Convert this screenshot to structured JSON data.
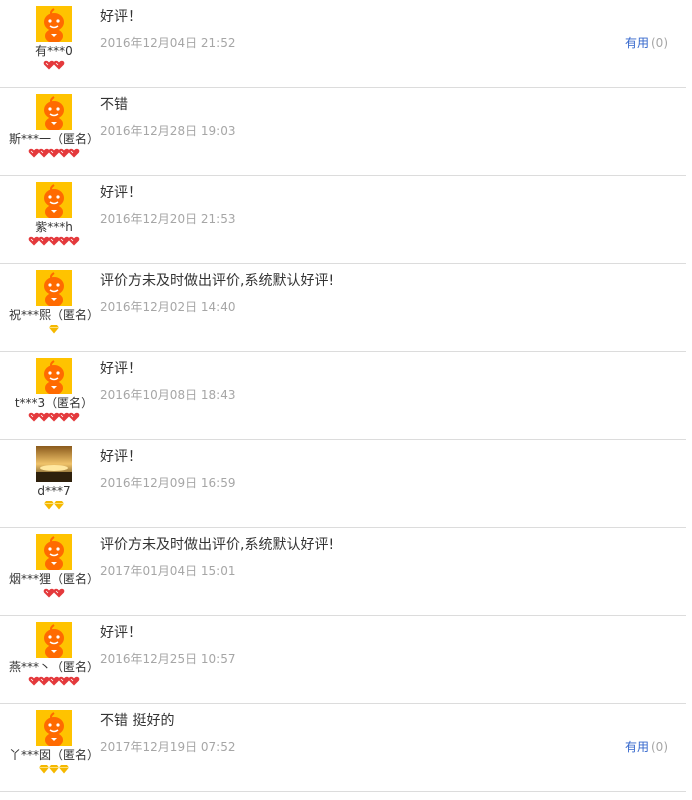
{
  "reviews": [
    {
      "comment": "好评！",
      "date": "2016年12月04日 21:52",
      "user": "有***0",
      "avatar": "taobao-mascot",
      "rank_icon": "red-heart",
      "rank_count": 2,
      "useful": {
        "label": "有用",
        "count": "(0)"
      }
    },
    {
      "comment": "不错",
      "date": "2016年12月28日 19:03",
      "user": "斯***一（匿名）",
      "avatar": "taobao-mascot",
      "rank_icon": "red-heart",
      "rank_count": 5
    },
    {
      "comment": "好评！",
      "date": "2016年12月20日 21:53",
      "user": "紫***h",
      "avatar": "taobao-mascot",
      "rank_icon": "red-heart",
      "rank_count": 5
    },
    {
      "comment": "评价方未及时做出评价,系统默认好评!",
      "date": "2016年12月02日 14:40",
      "user": "祝***熙（匿名）",
      "avatar": "taobao-mascot",
      "rank_icon": "yellow-diamond",
      "rank_count": 1
    },
    {
      "comment": "好评！",
      "date": "2016年10月08日 18:43",
      "user": "t***3（匿名）",
      "avatar": "taobao-mascot",
      "rank_icon": "red-heart",
      "rank_count": 5
    },
    {
      "comment": "好评！",
      "date": "2016年12月09日 16:59",
      "user": "d***7",
      "avatar": "sunset-photo",
      "rank_icon": "yellow-diamond",
      "rank_count": 2
    },
    {
      "comment": "评价方未及时做出评价,系统默认好评!",
      "date": "2017年01月04日 15:01",
      "user": "烟***狸（匿名）",
      "avatar": "taobao-mascot",
      "rank_icon": "red-heart",
      "rank_count": 2
    },
    {
      "comment": "好评！",
      "date": "2016年12月25日 10:57",
      "user": "燕***丶（匿名）",
      "avatar": "taobao-mascot",
      "rank_icon": "red-heart",
      "rank_count": 5
    },
    {
      "comment": "不错 挺好的",
      "date": "2017年12月19日 07:52",
      "user": "丫***囡（匿名）",
      "avatar": "taobao-mascot",
      "rank_icon": "yellow-diamond",
      "rank_count": 3,
      "useful": {
        "label": "有用",
        "count": "(0)"
      }
    }
  ],
  "colors": {
    "useful_link": "#3366cc",
    "date_text": "#a6a6a6",
    "divider": "#dcdcdc",
    "heart": "#e4393c",
    "diamond": "#f5b800",
    "avatar_bg": "#ffc300",
    "mascot": "#ff6a00"
  }
}
